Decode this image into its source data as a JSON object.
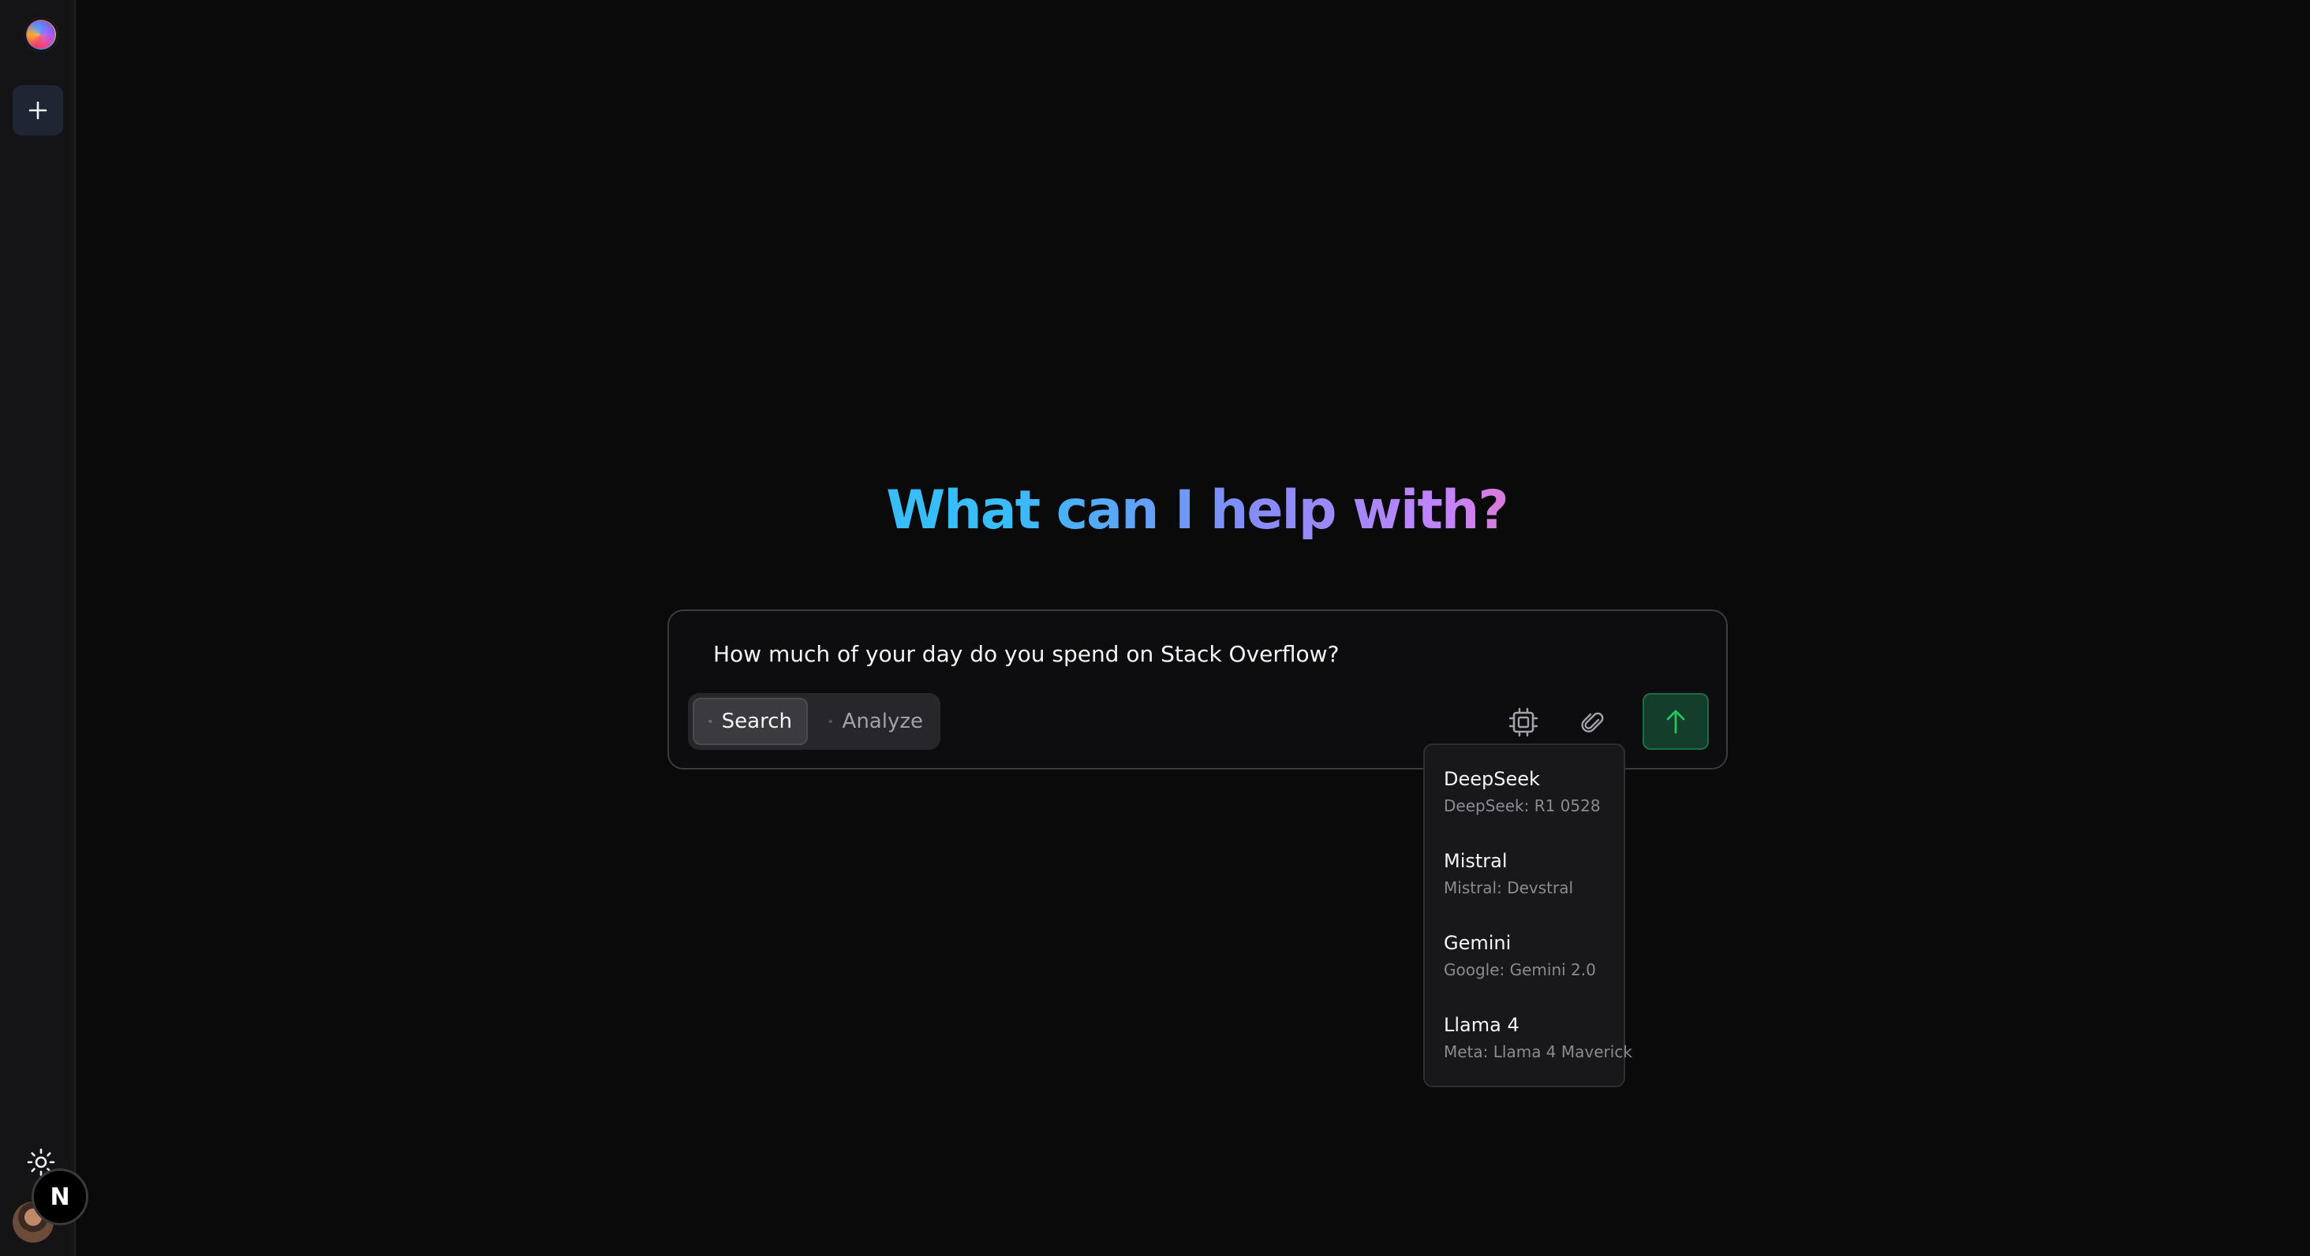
{
  "app": {
    "headline": "What can I help with?",
    "sidebar_badge": "N"
  },
  "composer": {
    "prompt": "How much of your day do you spend on Stack Overflow?",
    "modes": [
      {
        "label": "Search",
        "icon": "search-icon",
        "selected": true
      },
      {
        "label": "Analyze",
        "icon": "sparkle-icon",
        "selected": false
      }
    ],
    "tools": [
      "chip-icon",
      "paperclip-icon"
    ],
    "send_icon": "arrow-up-icon"
  },
  "model_menu": {
    "items": [
      {
        "name": "DeepSeek",
        "model": "DeepSeek: R1 0528"
      },
      {
        "name": "Mistral",
        "model": "Mistral: Devstral"
      },
      {
        "name": "Gemini",
        "model": "Google: Gemini 2.0"
      },
      {
        "name": "Llama 4",
        "model": "Meta: Llama 4 Maverick"
      }
    ]
  },
  "colors": {
    "background": "#0a0a0b",
    "sidebar": "#141417",
    "send_button": "#143d2b",
    "send_accent": "#22c55e",
    "headline_gradient": [
      "#38bdf8",
      "#818cf8",
      "#c084fc",
      "#f472b6"
    ]
  }
}
